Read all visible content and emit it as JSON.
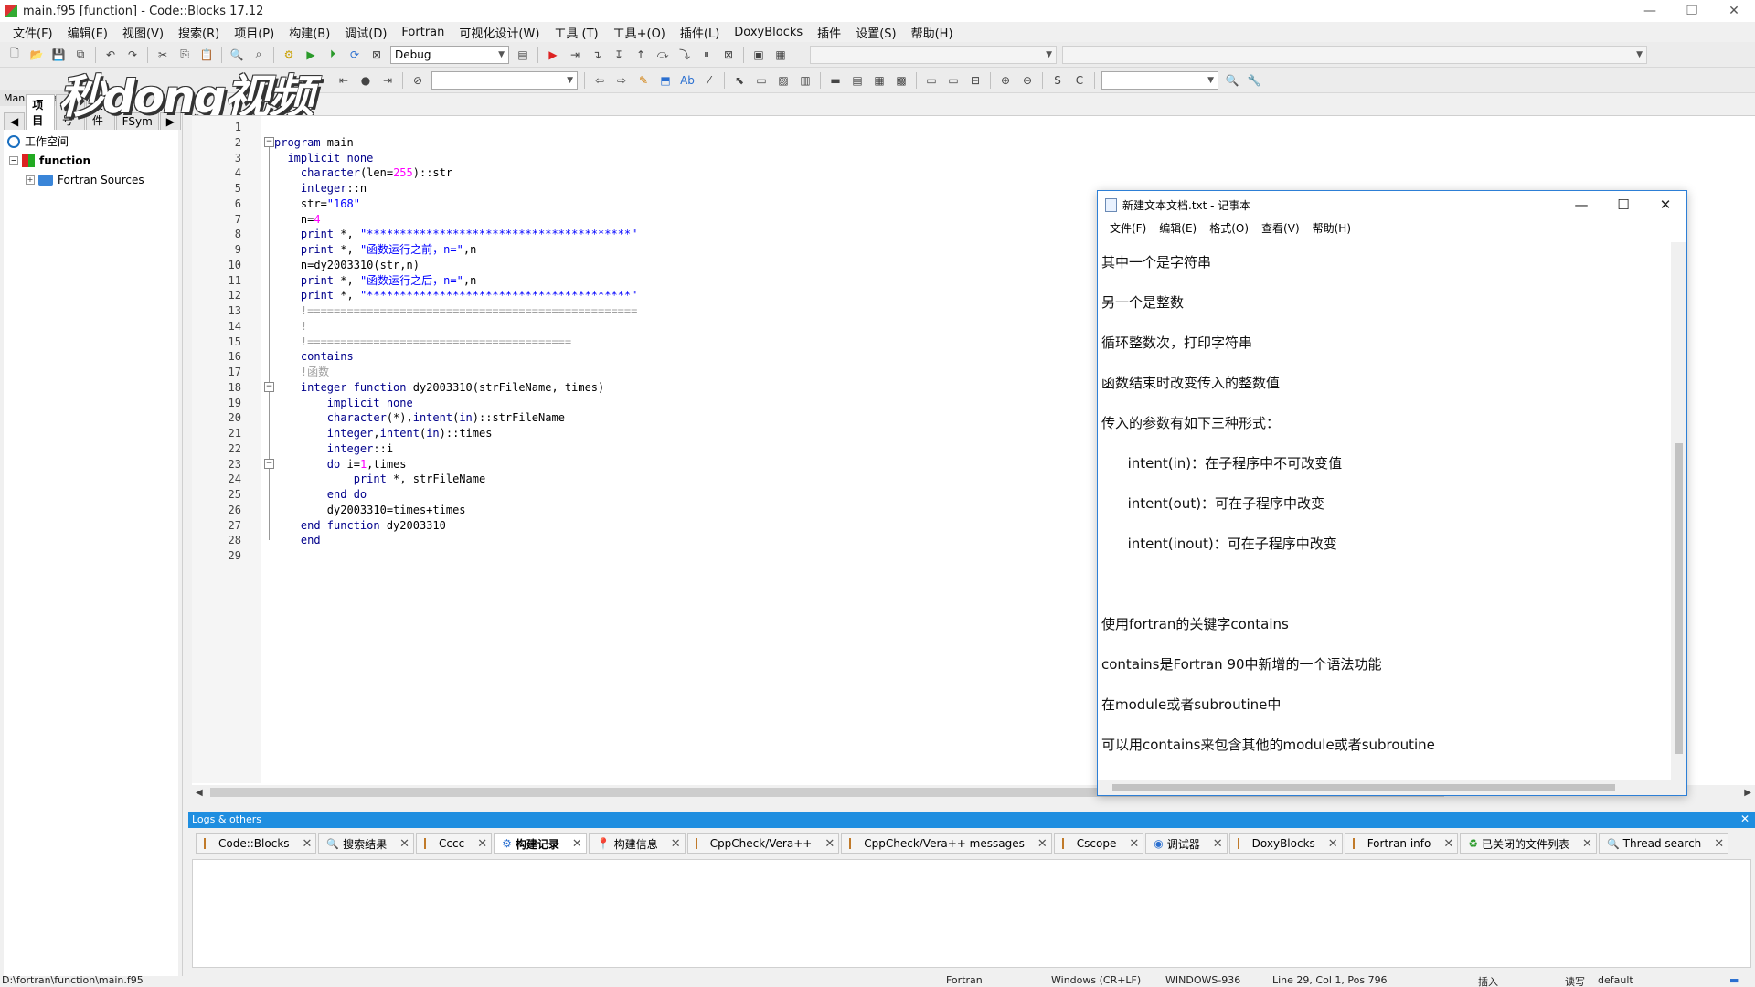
{
  "window": {
    "title": "main.f95 [function] - Code::Blocks 17.12",
    "controls": [
      "minimize-icon",
      "restore-icon",
      "close-icon"
    ]
  },
  "menu": [
    "文件(F)",
    "编辑(E)",
    "视图(V)",
    "搜索(R)",
    "项目(P)",
    "构建(B)",
    "调试(D)",
    "Fortran",
    "可视化设计(W)",
    "工具 (T)",
    "工具+(O)",
    "插件(L)",
    "DoxyBlocks",
    "插件",
    "设置(S)",
    "帮助(H)"
  ],
  "toolbar": {
    "build_target": "Debug"
  },
  "watermark": "秒dong视频",
  "management": {
    "title": "Management",
    "tabs": [
      "项目",
      "符号",
      "文件",
      "FSym"
    ],
    "tree": {
      "workspace": "工作空间",
      "project": "function",
      "folder": "Fortran Sources"
    }
  },
  "editor": {
    "line_numbers": [
      "1",
      "2",
      "3",
      "4",
      "5",
      "6",
      "7",
      "8",
      "9",
      "10",
      "11",
      "12",
      "13",
      "14",
      "15",
      "16",
      "17",
      "18",
      "19",
      "20",
      "21",
      "22",
      "23",
      "24",
      "25",
      "26",
      "27",
      "28",
      "29"
    ]
  },
  "notepad": {
    "title": "新建文本文档.txt - 记事本",
    "menu": [
      "文件(F)",
      "编辑(E)",
      "格式(O)",
      "查看(V)",
      "帮助(H)"
    ],
    "lines": [
      "其中一个是字符串",
      "另一个是整数",
      "循环整数次，打印字符串",
      "函数结束时改变传入的整数值",
      "传入的参数有如下三种形式：",
      "      intent(in)：在子程序中不可改变值",
      "      intent(out)：可在子程序中改变",
      "      intent(inout)：可在子程序中改变",
      "",
      "使用fortran的关键字contains",
      "contains是Fortran 90中新增的一个语法功能",
      "在module或者subroutine中",
      "可以用contains来包含其他的module或者subroutine"
    ]
  },
  "logs": {
    "title": "Logs & others",
    "tabs": [
      "Code::Blocks",
      "搜索结果",
      "Cccc",
      "构建记录",
      "构建信息",
      "CppCheck/Vera++",
      "CppCheck/Vera++ messages",
      "Cscope",
      "调试器",
      "DoxyBlocks",
      "Fortran info",
      "已关闭的文件列表",
      "Thread search"
    ],
    "active_tab": "构建记录"
  },
  "status": {
    "path": "D:\\fortran\\function\\main.f95",
    "language": "Fortran",
    "eol": "Windows (CR+LF)",
    "encoding": "WINDOWS-936",
    "position": "Line 29, Col 1, Pos 796",
    "mode": "插入",
    "rw": "读写",
    "profile": "default"
  }
}
